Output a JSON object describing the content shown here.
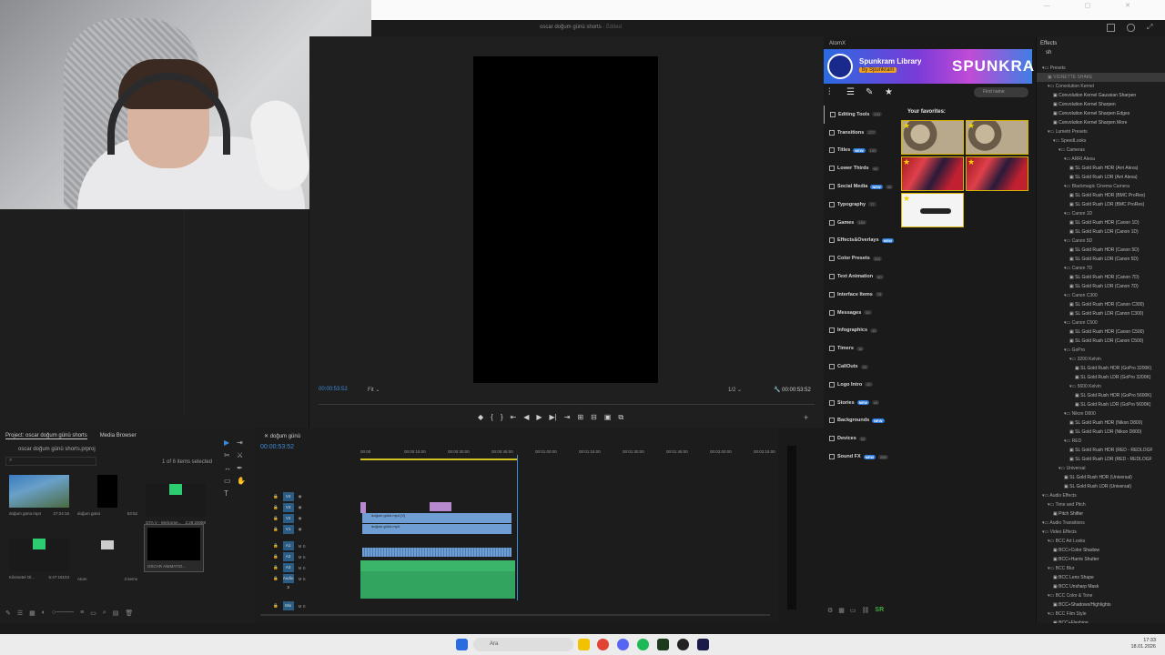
{
  "window": {
    "title": "oscar doğum günü shorts",
    "edited_label": "- Edited"
  },
  "program_monitor": {
    "timecode": "00:00:53:52",
    "fit": "Fit",
    "resolution": "1/2",
    "duration": "00:00:53:52"
  },
  "atomx": {
    "panel_title": "AtomX",
    "banner_title": "Spunkram Library",
    "banner_by": "by Spunkram",
    "banner_brand": "SPUNKRA",
    "search_placeholder": "Find name",
    "favorites_title": "Your favorites:",
    "categories": [
      {
        "label": "Editing Tools",
        "count": "142",
        "new": ""
      },
      {
        "label": "Transitions",
        "count": "277",
        "new": ""
      },
      {
        "label": "Titles",
        "count": "193",
        "new": "NEW"
      },
      {
        "label": "Lower Thirds",
        "count": "60",
        "new": ""
      },
      {
        "label": "Social Media",
        "count": "45",
        "new": "NEW"
      },
      {
        "label": "Typography",
        "count": "77",
        "new": ""
      },
      {
        "label": "Games",
        "count": "154",
        "new": ""
      },
      {
        "label": "Effects&Overlays",
        "count": "",
        "new": "NEW"
      },
      {
        "label": "Color Presets",
        "count": "110",
        "new": ""
      },
      {
        "label": "Text Animation",
        "count": "40",
        "new": ""
      },
      {
        "label": "Interface Items",
        "count": "75",
        "new": ""
      },
      {
        "label": "Messages",
        "count": "54",
        "new": ""
      },
      {
        "label": "Infographics",
        "count": "40",
        "new": ""
      },
      {
        "label": "Timers",
        "count": "16",
        "new": ""
      },
      {
        "label": "CallOuts",
        "count": "20",
        "new": ""
      },
      {
        "label": "Logo Intro",
        "count": "20",
        "new": ""
      },
      {
        "label": "Stories",
        "count": "44",
        "new": "NEW"
      },
      {
        "label": "Backgrounds",
        "count": "",
        "new": "NEW"
      },
      {
        "label": "Devices",
        "count": "33",
        "new": ""
      },
      {
        "label": "Sound FX",
        "count": "288",
        "new": "NEW"
      }
    ],
    "bottom_label": "SR"
  },
  "effects": {
    "panel_title": "Effects",
    "search_value": "sh",
    "tree": [
      {
        "label": "Presets",
        "indent": 1,
        "folder": true
      },
      {
        "label": "VIGNETTE SHAKE",
        "indent": 2,
        "folder": false,
        "highlight": true
      },
      {
        "label": "Convolution Kernel",
        "indent": 2,
        "folder": true
      },
      {
        "label": "Convolution Kernel Gaussian Sharpen",
        "indent": 3,
        "folder": false
      },
      {
        "label": "Convolution Kernel Sharpen",
        "indent": 3,
        "folder": false
      },
      {
        "label": "Convolution Kernel Sharpen Edges",
        "indent": 3,
        "folder": false
      },
      {
        "label": "Convolution Kernel Sharpen More",
        "indent": 3,
        "folder": false
      },
      {
        "label": "Lumetri Presets",
        "indent": 2,
        "folder": true
      },
      {
        "label": "SpeedLooks",
        "indent": 3,
        "folder": true
      },
      {
        "label": "Cameras",
        "indent": 4,
        "folder": true
      },
      {
        "label": "ARRI Alexa",
        "indent": 5,
        "folder": true
      },
      {
        "label": "SL Gold Rush HDR (Arri Alexa)",
        "indent": 6,
        "folder": false
      },
      {
        "label": "SL Gold Rush LDR (Arri Alexa)",
        "indent": 6,
        "folder": false
      },
      {
        "label": "Blackmagic Cinema Camera",
        "indent": 5,
        "folder": true
      },
      {
        "label": "SL Gold Rush HDR (BMC ProRes)",
        "indent": 6,
        "folder": false
      },
      {
        "label": "SL Gold Rush LDR (BMC ProRes)",
        "indent": 6,
        "folder": false
      },
      {
        "label": "Canon 1D",
        "indent": 5,
        "folder": true
      },
      {
        "label": "SL Gold Rush HDR (Canon 1D)",
        "indent": 6,
        "folder": false
      },
      {
        "label": "SL Gold Rush LDR (Canon 1D)",
        "indent": 6,
        "folder": false
      },
      {
        "label": "Canon 5D",
        "indent": 5,
        "folder": true
      },
      {
        "label": "SL Gold Rush HDR (Canon 5D)",
        "indent": 6,
        "folder": false
      },
      {
        "label": "SL Gold Rush LDR (Canon 5D)",
        "indent": 6,
        "folder": false
      },
      {
        "label": "Canon 7D",
        "indent": 5,
        "folder": true
      },
      {
        "label": "SL Gold Rush HDR (Canon 7D)",
        "indent": 6,
        "folder": false
      },
      {
        "label": "SL Gold Rush LDR (Canon 7D)",
        "indent": 6,
        "folder": false
      },
      {
        "label": "Canon C300",
        "indent": 5,
        "folder": true
      },
      {
        "label": "SL Gold Rush HDR (Canon C300)",
        "indent": 6,
        "folder": false
      },
      {
        "label": "SL Gold Rush LDR (Canon C300)",
        "indent": 6,
        "folder": false
      },
      {
        "label": "Canon C500",
        "indent": 5,
        "folder": true
      },
      {
        "label": "SL Gold Rush HDR (Canon C500)",
        "indent": 6,
        "folder": false
      },
      {
        "label": "SL Gold Rush LDR (Canon C500)",
        "indent": 6,
        "folder": false
      },
      {
        "label": "GoPro",
        "indent": 5,
        "folder": true
      },
      {
        "label": "3200 Kelvin",
        "indent": 6,
        "folder": true
      },
      {
        "label": "SL Gold Rush HDR (GoPro 3200K)",
        "indent": 7,
        "folder": false
      },
      {
        "label": "SL Gold Rush LDR (GoPro 3200K)",
        "indent": 7,
        "folder": false
      },
      {
        "label": "5600 Kelvin",
        "indent": 6,
        "folder": true
      },
      {
        "label": "SL Gold Rush HDR (GoPro 5600K)",
        "indent": 7,
        "folder": false
      },
      {
        "label": "SL Gold Rush LDR (GoPro 5600K)",
        "indent": 7,
        "folder": false
      },
      {
        "label": "Nikon D800",
        "indent": 5,
        "folder": true
      },
      {
        "label": "SL Gold Rush HDR (Nikon D800)",
        "indent": 6,
        "folder": false
      },
      {
        "label": "SL Gold Rush LDR (Nikon D800)",
        "indent": 6,
        "folder": false
      },
      {
        "label": "RED",
        "indent": 5,
        "folder": true
      },
      {
        "label": "SL Gold Rush HDR (RED - REDLOGF",
        "indent": 6,
        "folder": false
      },
      {
        "label": "SL Gold Rush LDR (RED - REDLOGF",
        "indent": 6,
        "folder": false
      },
      {
        "label": "Universal",
        "indent": 4,
        "folder": true
      },
      {
        "label": "SL Gold Rush HDR (Universal)",
        "indent": 5,
        "folder": false
      },
      {
        "label": "SL Gold Rush LDR (Universal)",
        "indent": 5,
        "folder": false
      },
      {
        "label": "Audio Effects",
        "indent": 1,
        "folder": true
      },
      {
        "label": "Time and Pitch",
        "indent": 2,
        "folder": true
      },
      {
        "label": "Pitch Shifter",
        "indent": 3,
        "folder": false
      },
      {
        "label": "Audio Transitions",
        "indent": 1,
        "folder": true
      },
      {
        "label": "Video Effects",
        "indent": 1,
        "folder": true
      },
      {
        "label": "BCC Art Looks",
        "indent": 2,
        "folder": true
      },
      {
        "label": "BCC+Color Shadow",
        "indent": 3,
        "folder": false
      },
      {
        "label": "BCC+Harris Shutter",
        "indent": 3,
        "folder": false
      },
      {
        "label": "BCC Blur",
        "indent": 2,
        "folder": true
      },
      {
        "label": "BCC Lens Shape",
        "indent": 3,
        "folder": false
      },
      {
        "label": "BCC Unsharp Mask",
        "indent": 3,
        "folder": false
      },
      {
        "label": "BCC Color & Tone",
        "indent": 2,
        "folder": true
      },
      {
        "label": "BCC+Shadows/Highlights",
        "indent": 3,
        "folder": false
      },
      {
        "label": "BCC Film Style",
        "indent": 2,
        "folder": true
      },
      {
        "label": "BCC+Flashing",
        "indent": 3,
        "folder": false
      }
    ]
  },
  "project": {
    "tab_project": "Project: oscar doğum günü shorts",
    "tab_media": "Media Browser",
    "file": "oscar doğum günü shorts.prproj",
    "count": "1 of 6 items selected",
    "bins": [
      {
        "name": "doğum günü.mp4",
        "meta": "27:24:16"
      },
      {
        "name": "doğum günü",
        "meta": "53:52"
      },
      {
        "name": "GTA V - Welcome...",
        "meta": "2:29:20088"
      },
      {
        "name": "Kilometel Ol...",
        "meta": "5:47:18104"
      },
      {
        "name": "Atom",
        "meta": "3 items"
      },
      {
        "name": "OSCAR ANIMATIO...",
        "meta": ""
      }
    ]
  },
  "timeline": {
    "tab": "doğum günü",
    "timecode": "00:00:53:52",
    "ruler": [
      "00:00",
      "00:00:15:00",
      "00:00:30:00",
      "00:00:45:00",
      "00:01:00:00",
      "00:01:15:00",
      "00:01:30:00",
      "00:01:45:00",
      "00:02:00:00",
      "00:02:15:00"
    ],
    "tracks": [
      "V4",
      "V3",
      "V2",
      "V1",
      "A1",
      "A2",
      "A3",
      "Audio 3",
      "Mix"
    ],
    "clip_v1": "doğum günü.mp4 [V]",
    "clip_v1b": "doğum günü.mp4",
    "mix_value": "0.0"
  },
  "taskbar": {
    "search": "Ara",
    "time": "17:33",
    "date": "18.01.2026"
  }
}
